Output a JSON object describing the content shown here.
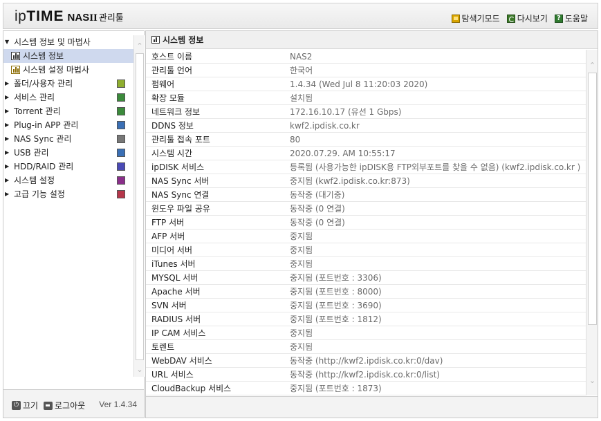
{
  "header": {
    "logo_ip": "ip",
    "logo_time": "TIME",
    "logo_nas": "NAS",
    "logo_roman": "II",
    "logo_manager": "관리툴",
    "actions": [
      {
        "label": "탐색기모드",
        "icon": "folder-icon"
      },
      {
        "label": "다시보기",
        "icon": "refresh-icon"
      },
      {
        "label": "도움말",
        "icon": "help-icon"
      }
    ]
  },
  "sidebar": {
    "group_label": "시스템 정보 및 마법사",
    "children": [
      {
        "label": "시스템 정보",
        "selected": true
      },
      {
        "label": "시스템 설정 마법사",
        "selected": false
      }
    ],
    "items": [
      {
        "label": "폴더/사용자 관리",
        "icon_color": "#8fae2f"
      },
      {
        "label": "서비스 관리",
        "icon_color": "#3b8a3b"
      },
      {
        "label": "Torrent 관리",
        "icon_color": "#3b8a3b"
      },
      {
        "label": "Plug-in APP 관리",
        "icon_color": "#3a6fb5"
      },
      {
        "label": "NAS Sync 관리",
        "icon_color": "#777777"
      },
      {
        "label": "USB 관리",
        "icon_color": "#3a6fb5"
      },
      {
        "label": "HDD/RAID 관리",
        "icon_color": "#4a4ab5"
      },
      {
        "label": "시스템 설정",
        "icon_color": "#8a2f8a"
      },
      {
        "label": "고급 기능 설정",
        "icon_color": "#b5364a"
      }
    ],
    "footer": {
      "power_label": "끄기",
      "logout_label": "로그아웃",
      "version": "Ver 1.4.34"
    }
  },
  "main": {
    "title": "시스템 정보",
    "rows": [
      {
        "key": "호스트 이름",
        "value": "NAS2"
      },
      {
        "key": "관리툴 언어",
        "value": "한국어"
      },
      {
        "key": "펌웨어",
        "value": "1.4.34 (Wed Jul 8 11:20:03 2020)"
      },
      {
        "key": "확장 모듈",
        "value": "설치됨"
      },
      {
        "key": "네트워크 정보",
        "value": "172.16.10.17 (유선 1 Gbps)"
      },
      {
        "key": "DDNS 정보",
        "value": "kwf2.ipdisk.co.kr"
      },
      {
        "key": "관리툴 접속 포트",
        "value": "80"
      },
      {
        "key": "시스템 시간",
        "value": "2020.07.29. AM 10:55:17"
      },
      {
        "key": "ipDISK 서비스",
        "value": "등록됨 (사용가능한 ipDISK용 FTP외부포트를 찾을 수 없음) (kwf2.ipdisk.co.kr )"
      },
      {
        "key": "NAS Sync 서버",
        "value": "중지됨 (kwf2.ipdisk.co.kr:873)"
      },
      {
        "key": "NAS Sync 연결",
        "value": "동작중 (대기중)"
      },
      {
        "key": "윈도우 파일 공유",
        "value": "동작중 (0 연결)"
      },
      {
        "key": "FTP 서버",
        "value": "동작중 (0 연결)"
      },
      {
        "key": "AFP 서버",
        "value": "중지됨"
      },
      {
        "key": "미디어 서버",
        "value": "중지됨"
      },
      {
        "key": "iTunes 서버",
        "value": "중지됨"
      },
      {
        "key": "MYSQL 서버",
        "value": "중지됨 (포트번호 : 3306)"
      },
      {
        "key": "Apache 서버",
        "value": "중지됨 (포트번호 : 8000)"
      },
      {
        "key": "SVN 서버",
        "value": "중지됨 (포트번호 : 3690)"
      },
      {
        "key": "RADIUS 서버",
        "value": "중지됨 (포트번호 : 1812)"
      },
      {
        "key": "IP CAM 서비스",
        "value": "중지됨"
      },
      {
        "key": "토렌트",
        "value": "중지됨"
      },
      {
        "key": "WebDAV 서비스",
        "value": "동작중 (http://kwf2.ipdisk.co.kr:0/dav)"
      },
      {
        "key": "URL 서비스",
        "value": "동작중 (http://kwf2.ipdisk.co.kr:0/list)"
      },
      {
        "key": "CloudBackup 서비스",
        "value": "중지됨 (포트번호 : 1873)"
      }
    ]
  }
}
